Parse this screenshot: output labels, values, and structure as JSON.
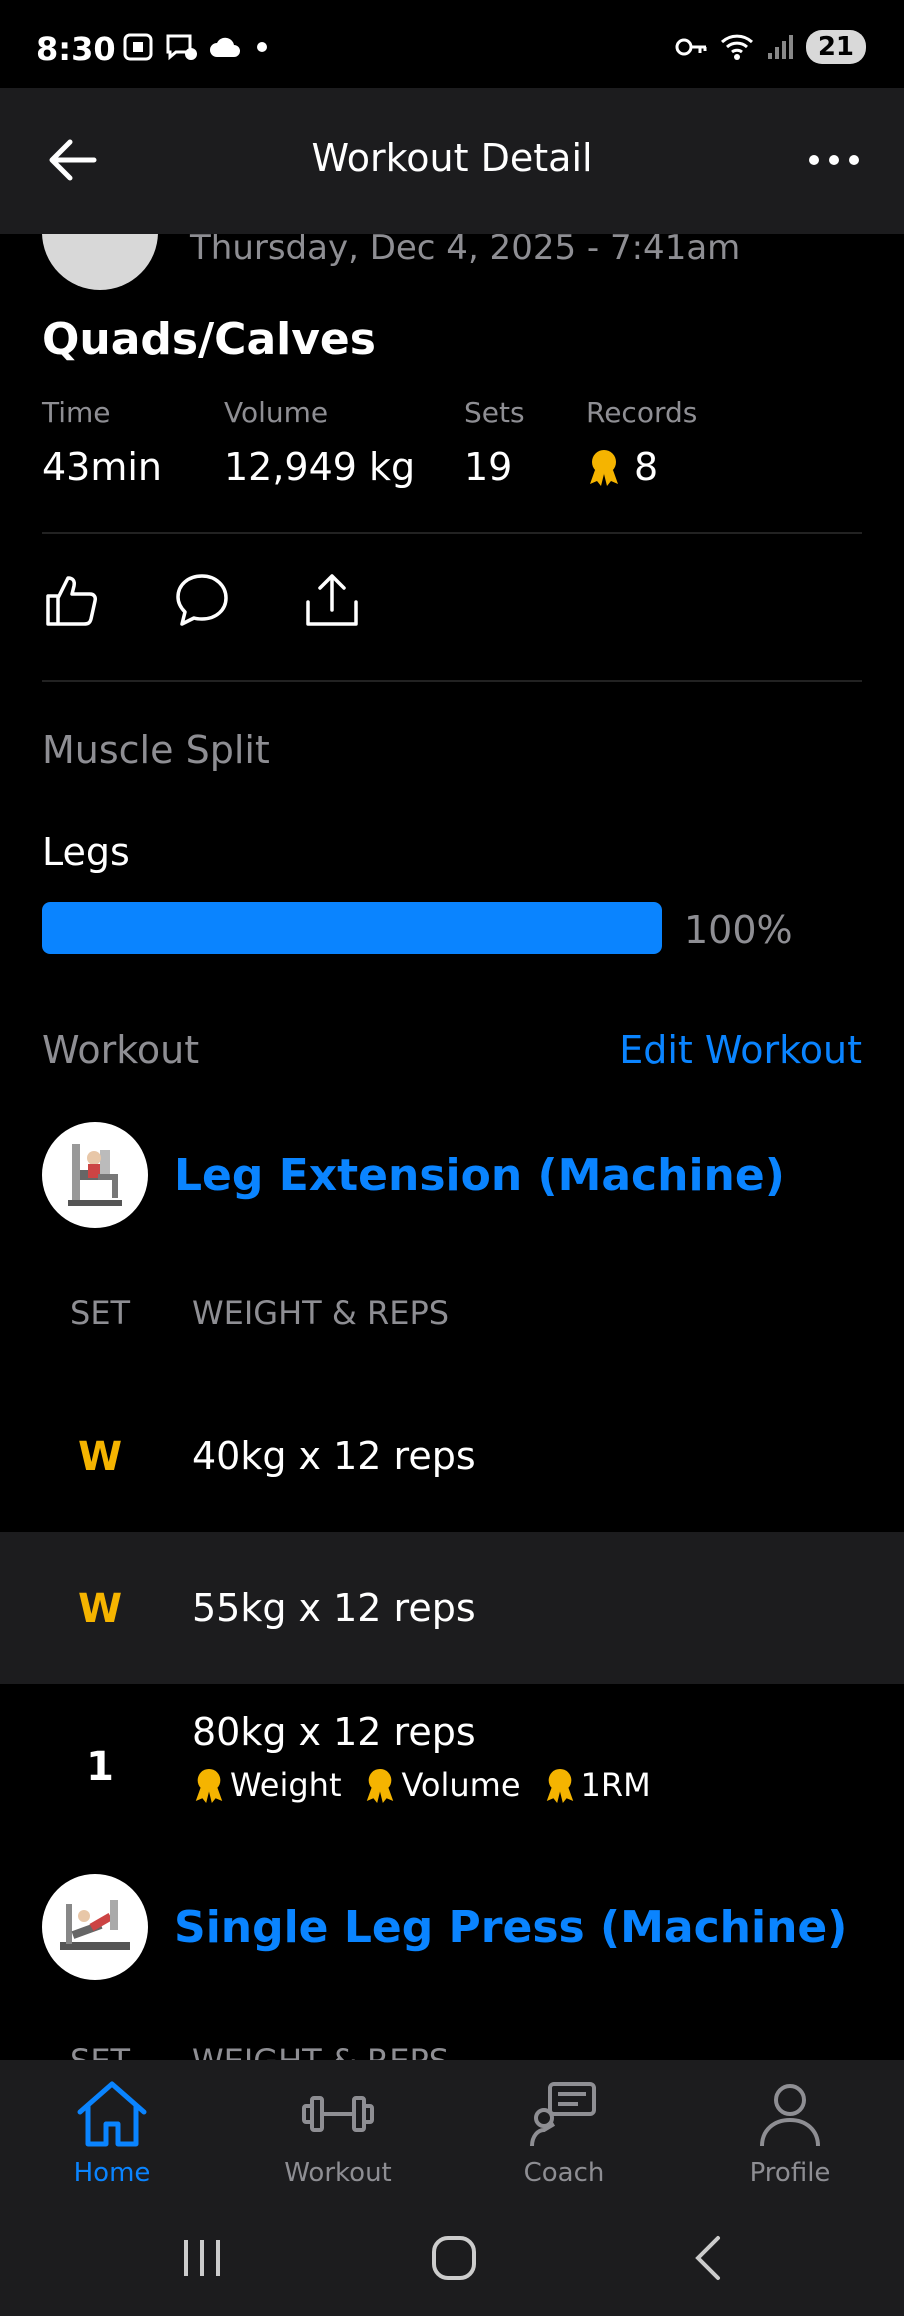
{
  "status_bar": {
    "time": "8:30",
    "battery": "21"
  },
  "app_bar": {
    "title": "Workout Detail"
  },
  "workout": {
    "date": "Thursday, Dec 4, 2025 - 7:41am",
    "title": "Quads/Calves",
    "stats": [
      {
        "label": "Time",
        "value": "43min"
      },
      {
        "label": "Volume",
        "value": "12,949 kg"
      },
      {
        "label": "Sets",
        "value": "19"
      },
      {
        "label": "Records",
        "value": "8"
      }
    ]
  },
  "muscle_split": {
    "heading": "Muscle Split",
    "items": [
      {
        "label": "Legs",
        "percent_text": "100%",
        "fraction": 1.0
      }
    ]
  },
  "workout_section": {
    "heading": "Workout",
    "edit_label": "Edit Workout"
  },
  "exercises": [
    {
      "name": "Leg Extension (Machine)",
      "col_set": "SET",
      "col_weight": "WEIGHT & REPS",
      "sets": [
        {
          "num": "W",
          "text": "40kg x 12 reps"
        },
        {
          "num": "W",
          "text": "55kg x 12 reps"
        },
        {
          "num": "1",
          "text": "80kg x 12 reps",
          "records": [
            "Weight",
            "Volume",
            "1RM"
          ]
        }
      ]
    },
    {
      "name": "Single Leg Press (Machine)",
      "col_set": "SET",
      "col_weight": "WEIGHT & REPS"
    }
  ],
  "tabs": [
    {
      "label": "Home",
      "icon": "home-icon",
      "active": true
    },
    {
      "label": "Workout",
      "icon": "dumbbell-icon",
      "active": false
    },
    {
      "label": "Coach",
      "icon": "coach-icon",
      "active": false
    },
    {
      "label": "Profile",
      "icon": "profile-icon",
      "active": false
    }
  ],
  "colors": {
    "accent": "#0a84ff",
    "warmup": "#f5b400",
    "medal": "#f5b400",
    "surface": "#1c1c1e"
  }
}
